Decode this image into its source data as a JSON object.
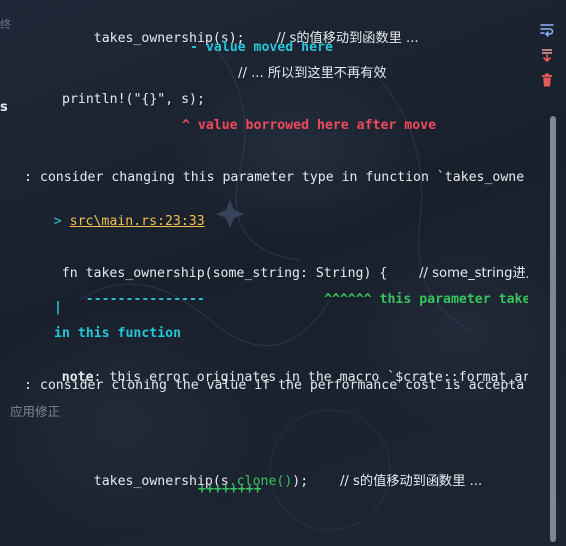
{
  "console": {
    "line1_code": "takes_ownership(s);",
    "line1_comment": "// s的值移动到函数里 ...",
    "line2": "- value moved here",
    "line3": "// ... 所以到这里不再有效",
    "line4": "println!(\"{}\", s);",
    "line5": "^ value borrowed here after move",
    "line6": ": consider changing this parameter type in function `takes_owne",
    "line7_prefix": ">",
    "line7_link": "src\\main.rs:23:33",
    "line8_code": "fn takes_ownership(some_string: String) {",
    "line8_comment": "// some_string进入",
    "line9_dashes": "---------------",
    "line9_carets": "^^^^^^ this parameter takes ow",
    "line10": "|",
    "line11": "in this function",
    "line12_note": "note",
    "line12_rest": ": this error originates in the macro `$crate::format_args_",
    "line13": ": consider cloning the value if the performance cost is accepta",
    "line14": "应用修正",
    "line15_a": "takes_ownership(s",
    "line15_b": ".clone()",
    "line15_c": ");",
    "line15_comment": "// s的值移动到函数里 ...",
    "line16": "++++++++"
  },
  "left_edge": {
    "a": "终",
    "b": "s"
  },
  "sidebar": {
    "icons": [
      "soft-wrap-icon",
      "scroll-to-end-icon",
      "trash-icon"
    ]
  },
  "colors": {
    "cyan": "#27c6d8",
    "red": "#f0495b",
    "green": "#37c35a",
    "link": "#f2c14e",
    "trash": "#e85a5a"
  }
}
